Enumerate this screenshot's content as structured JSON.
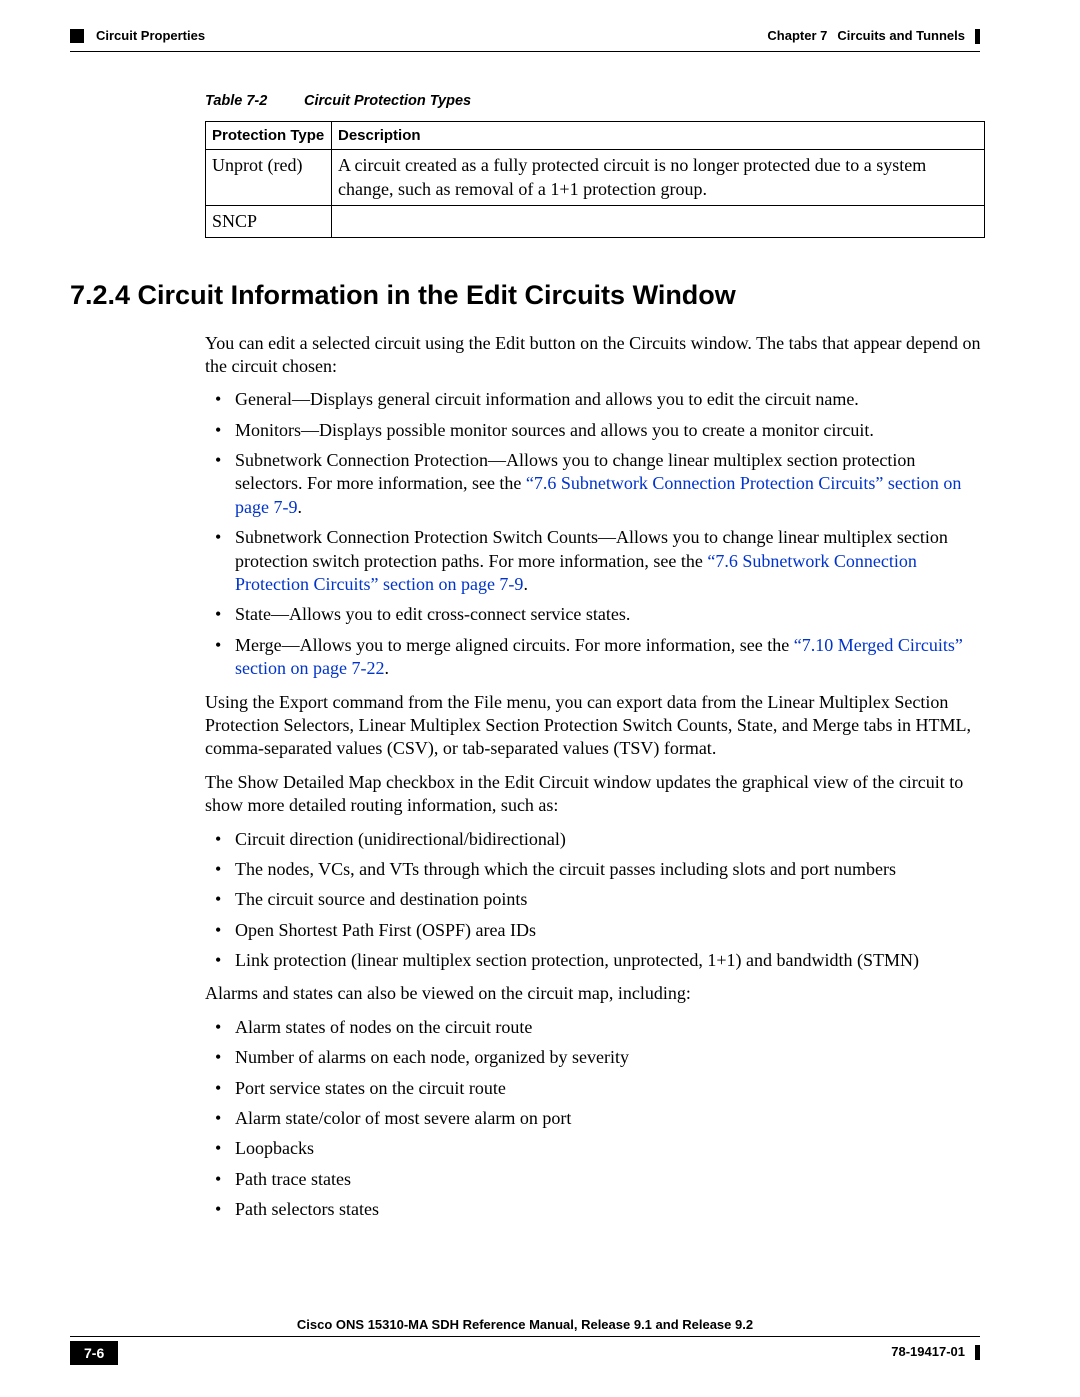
{
  "header": {
    "section": "Circuit Properties",
    "chapter_label": "Chapter 7",
    "chapter_title": "Circuits and Tunnels"
  },
  "table": {
    "caption_label": "Table 7-2",
    "caption_title": "Circuit Protection Types",
    "col1": "Protection Type",
    "col2": "Description",
    "rows": [
      {
        "c1": "Unprot (red)",
        "c2": "A circuit created as a fully protected circuit is no longer protected due to a system change, such as removal of a 1+1 protection group."
      },
      {
        "c1": "SNCP",
        "c2": ""
      }
    ]
  },
  "heading": "7.2.4  Circuit Information in the Edit Circuits Window",
  "intro": "You can edit a selected circuit using the Edit button on the Circuits window. The tabs that appear depend on the circuit chosen:",
  "tabs": {
    "general": "General—Displays general circuit information and allows you to edit the circuit name.",
    "monitors": "Monitors—Displays possible monitor sources and allows you to create a monitor circuit.",
    "sncp_pre": "Subnetwork Connection Protection—Allows you to change linear multiplex section protection selectors. For more information, see the ",
    "sncp_link": "“7.6  Subnetwork Connection Protection Circuits” section on page 7-9",
    "sncp_post": ".",
    "sncp_sw_pre": "Subnetwork Connection Protection Switch Counts—Allows you to change linear multiplex section protection switch protection paths. For more information, see the ",
    "sncp_sw_link": "“7.6  Subnetwork Connection Protection Circuits” section on page 7-9",
    "sncp_sw_post": ".",
    "state": "State—Allows you to edit cross-connect service states.",
    "merge_pre": "Merge—Allows you to merge aligned circuits. For more information, see the ",
    "merge_link": "“7.10  Merged Circuits” section on page 7-22",
    "merge_post": "."
  },
  "export_para": "Using the Export command from the File menu, you can export data from the Linear Multiplex Section Protection Selectors, Linear Multiplex Section Protection Switch Counts, State, and Merge tabs in HTML, comma-separated values (CSV), or tab-separated values (TSV) format.",
  "map_para": "The Show Detailed Map checkbox in the Edit Circuit window updates the graphical view of the circuit to show more detailed routing information, such as:",
  "map_list": [
    "Circuit direction (unidirectional/bidirectional)",
    "The nodes, VCs, and VTs through which the circuit passes including slots and port numbers",
    "The circuit source and destination points",
    "Open Shortest Path First (OSPF) area IDs",
    "Link protection (linear multiplex section protection, unprotected, 1+1) and bandwidth (STMN)"
  ],
  "alarms_para": "Alarms and states can also be viewed on the circuit map, including:",
  "alarms_list": [
    "Alarm states of nodes on the circuit route",
    "Number of alarms on each node, organized by severity",
    "Port service states on the circuit route",
    "Alarm state/color of most severe alarm on port",
    "Loopbacks",
    "Path trace states",
    "Path selectors states"
  ],
  "footer": {
    "title": "Cisco ONS 15310-MA SDH Reference Manual, Release 9.1 and Release 9.2",
    "page": "7-6",
    "docnum": "78-19417-01"
  }
}
